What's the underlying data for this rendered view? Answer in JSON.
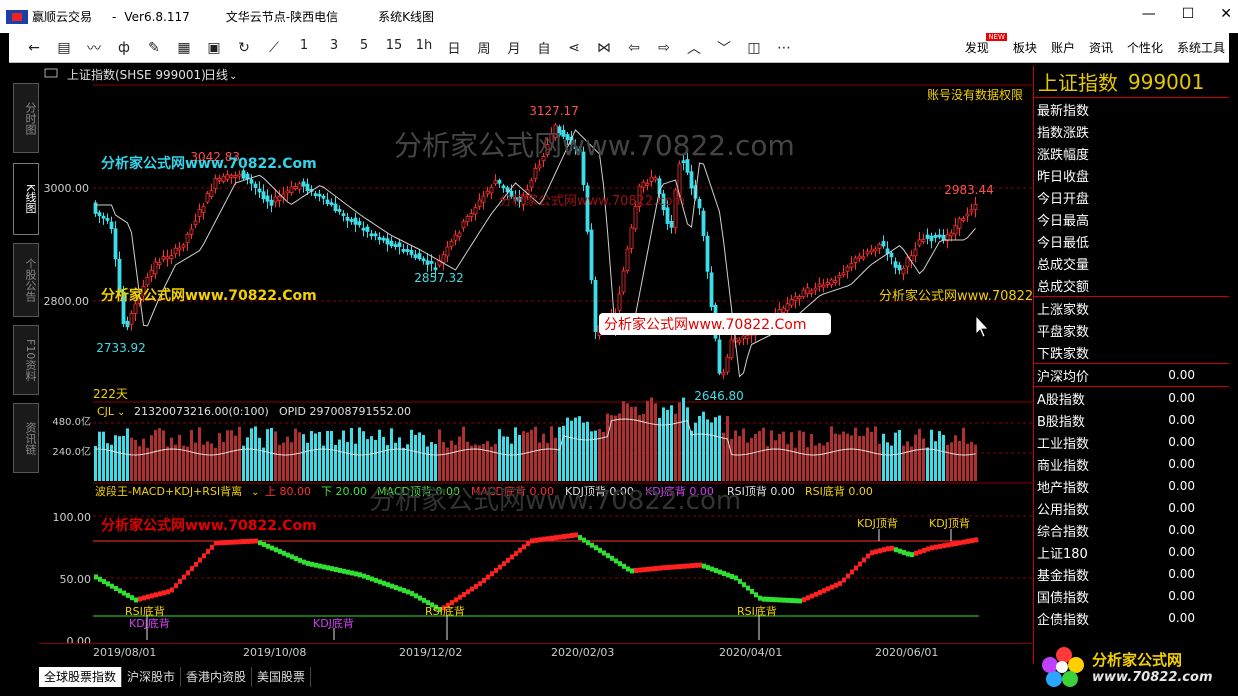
{
  "window": {
    "app_name": "赢顺云交易",
    "version": "Ver6.8.117",
    "server": "文华云节点-陕西电信",
    "system": "系统K线图"
  },
  "toolbar": {
    "periods": [
      "1",
      "3",
      "5",
      "15",
      "1h",
      "日",
      "周",
      "月",
      "自"
    ],
    "menu": [
      "发现",
      "板块",
      "账户",
      "资讯",
      "个性化",
      "系统工具"
    ],
    "new_badge": "NEW"
  },
  "left_tabs": [
    "分时图",
    "K线图",
    "个股公告",
    "F10资料",
    "资讯链"
  ],
  "chart": {
    "symbol_label": "上证指数(SHSE 999001)",
    "period_label": "日线",
    "no_permission": "账号没有数据权限",
    "days_label": "222天",
    "price_ticks": [
      "3000.00",
      "2800.00"
    ],
    "annotations": [
      "3127.17",
      "3042.83",
      "2857.32",
      "2733.92",
      "2646.80",
      "2983.44"
    ],
    "volume_header": {
      "name": "CJL",
      "value": "21320073216.00(0:100)",
      "opid": "OPID 297008791552.00"
    },
    "volume_ticks": [
      "480.0亿",
      "240.0亿"
    ],
    "indicator_header": {
      "name": "波段王-MACD+KDJ+RSI背离",
      "up": "上 80.00",
      "down": "下 20.00",
      "macd_top": "MACD顶背 0.00",
      "macd_bottom": "MACD底背 0.00",
      "kdj_top": "KDJ顶背 0.00",
      "kdj_bottom": "KDJ底背 0.00",
      "rsi_top": "RSI顶背 0.00",
      "rsi_bottom": "RSI底背 0.00"
    },
    "indicator_ticks": [
      "100.00",
      "50.00",
      "0.00"
    ],
    "signals": [
      "RSI底背",
      "KDJ底背",
      "KDJ底背",
      "RSI底背",
      "RSI底背",
      "KDJ顶背",
      "KDJ顶背"
    ],
    "x_labels": [
      "2019/08/01",
      "2019/10/08",
      "2019/12/02",
      "2020/02/03",
      "2020/04/01",
      "2020/06/01"
    ],
    "watermarks": [
      "分析家公式网www.70822.Com",
      "分析家公式网www.70822.com"
    ],
    "colors": {
      "up": "#ff3030",
      "down": "#3fdde8",
      "grid": "#8a0000",
      "ma": "#e0e0e0"
    }
  },
  "right_panel": {
    "title": "上证指数",
    "code": "999001",
    "group1": [
      "最新指数",
      "指数涨跌",
      "涨跌幅度",
      "昨日收盘",
      "今日开盘",
      "今日最高",
      "今日最低",
      "总成交量",
      "总成交额"
    ],
    "group2": [
      "上涨家数",
      "平盘家数",
      "下跌家数"
    ],
    "group3": [
      {
        "label": "沪深均价",
        "value": "0.00"
      }
    ],
    "group4": [
      {
        "label": "A股指数",
        "value": "0.00"
      },
      {
        "label": "B股指数",
        "value": "0.00"
      },
      {
        "label": "工业指数",
        "value": "0.00"
      },
      {
        "label": "商业指数",
        "value": "0.00"
      },
      {
        "label": "地产指数",
        "value": "0.00"
      },
      {
        "label": "公用指数",
        "value": "0.00"
      },
      {
        "label": "综合指数",
        "value": "0.00"
      },
      {
        "label": "上证180",
        "value": "0.00"
      },
      {
        "label": "基金指数",
        "value": "0.00"
      },
      {
        "label": "国债指数",
        "value": "0.00"
      },
      {
        "label": "企债指数",
        "value": "0.00"
      }
    ]
  },
  "bottom_tabs": [
    "全球股票指数",
    "沪深股市",
    "香港内资股",
    "美国股票"
  ],
  "brand": {
    "line1": "分析家公式网",
    "line2": "www.70822.com"
  }
}
